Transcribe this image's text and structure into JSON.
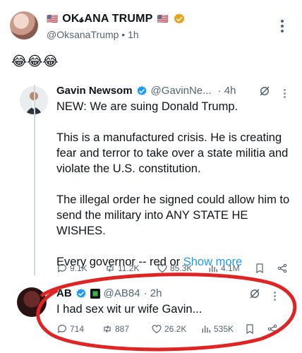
{
  "top_post": {
    "flag_left": "🇺🇸",
    "name": "OK𝓼ANA TRUMP",
    "flag_right": "🇺🇸",
    "handle": "@OksanaTrump",
    "sep": "•",
    "time": "1h",
    "emojis": "😂😂😂"
  },
  "quote": {
    "name": "Gavin Newsom",
    "handle": "@GavinNe...",
    "time": "· 4h",
    "lines": [
      "NEW: We are suing Donald Trump.",
      "This is a manufactured crisis. He is creating fear and terror to take over a state militia and violate the U.S. constitution.",
      "The illegal order he signed could allow him to send the military into ANY STATE HE WISHES.",
      "Every governor -- red or"
    ],
    "show_more": "Show more",
    "stats": {
      "replies": "9.1K",
      "reposts": "11.2K",
      "likes": "85.3K",
      "views": "4.1M"
    }
  },
  "reply": {
    "name": "AB",
    "handle": "@AB84",
    "time": "· 2h",
    "text": "I had sex wit ur wife Gavin...",
    "stats": {
      "replies": "714",
      "reposts": "887",
      "likes": "26.2K",
      "views": "535K"
    }
  },
  "colors": {
    "verified_gold": "#e8a21c",
    "verified_blue": "#1d9bf0",
    "annotation_red": "#e02424",
    "muted": "#536471"
  },
  "icons": [
    "verified-badge-icon",
    "grok-icon",
    "kebab-menu-icon",
    "reply-icon",
    "repost-icon",
    "like-icon",
    "views-icon",
    "bookmark-icon",
    "share-icon"
  ]
}
